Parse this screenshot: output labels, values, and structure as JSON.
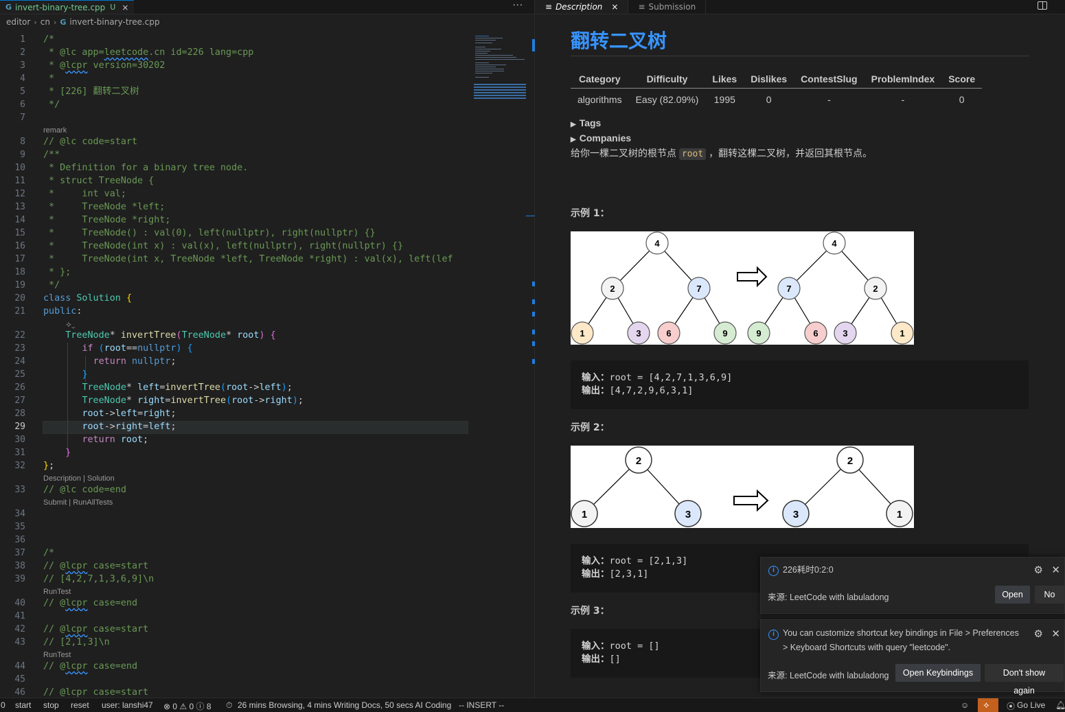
{
  "editor": {
    "tab": {
      "filename": "invert-binary-tree.cpp",
      "modified": "U",
      "close": "×"
    },
    "more": "···",
    "breadcrumb": [
      "editor",
      "cn",
      "invert-binary-tree.cpp"
    ],
    "lens": {
      "remark": "remark",
      "desc_solution": "Description | Solution",
      "submit_run": "Submit | RunAllTests",
      "runtest": "RunTest"
    },
    "current_line": 29
  },
  "right": {
    "tabs": [
      {
        "label": "Description",
        "close": "×"
      },
      {
        "label": "Submission"
      }
    ],
    "title": "翻转二叉树",
    "meta_headers": [
      "Category",
      "Difficulty",
      "Likes",
      "Dislikes",
      "ContestSlug",
      "ProblemIndex",
      "Score"
    ],
    "meta_values": [
      "algorithms",
      "Easy (82.09%)",
      "1995",
      "0",
      "-",
      "-",
      "0"
    ],
    "tags": "Tags",
    "companies": "Companies",
    "statement_pre": "给你一棵二叉树的根节点 ",
    "statement_code": "root",
    "statement_post": " ，翻转这棵二叉树，并返回其根节点。",
    "examples": [
      {
        "title": "示例 1：",
        "in_label": "输入：",
        "input": "root = [4,2,7,1,3,6,9]",
        "out_label": "输出：",
        "output": "[4,7,2,9,6,3,1]"
      },
      {
        "title": "示例 2：",
        "in_label": "输入：",
        "input": "root = [2,1,3]",
        "out_label": "输出：",
        "output": "[2,3,1]"
      },
      {
        "title": "示例 3：",
        "in_label": "输入：",
        "input": "root = []",
        "out_label": "输出：",
        "output": "[]"
      }
    ],
    "tree1_left": [
      "4",
      "2",
      "7",
      "1",
      "3",
      "6",
      "9"
    ],
    "tree1_right": [
      "4",
      "7",
      "2",
      "9",
      "6",
      "3",
      "1"
    ],
    "tree2_left": [
      "2",
      "1",
      "3"
    ],
    "tree2_right": [
      "2",
      "3",
      "1"
    ]
  },
  "notifications": [
    {
      "message": "226耗时0:2:0",
      "source": "来源: LeetCode with labuladong",
      "buttons": [
        "Open",
        "No"
      ]
    },
    {
      "message_line1": "You can customize shortcut key bindings in File > Preferences",
      "message_line2": "> Keyboard Shortcuts with query \"leetcode\".",
      "source": "来源: LeetCode with labuladong",
      "buttons": [
        "Open Keybindings",
        "Don't show again"
      ]
    }
  ],
  "status": {
    "left0": "0",
    "start": "start",
    "stop": "stop",
    "reset": "reset",
    "user": "user: lanshi47",
    "problems": "⊗ 0 ⚠ 0 ⓘ 8",
    "activity": "26 mins Browsing, 4 mins Writing Docs, 50 secs AI Coding",
    "mode": "-- INSERT --",
    "golive": "Go Live"
  },
  "colors": {
    "accent": "#3794ff",
    "tab_modified": "#73c991",
    "leetcode_badge": "#c4601d"
  }
}
